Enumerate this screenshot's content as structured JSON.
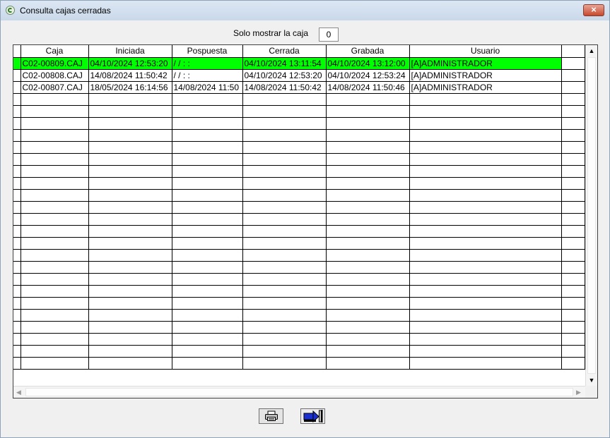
{
  "window": {
    "title": "Consulta cajas cerradas",
    "close_label": "×"
  },
  "filter": {
    "label": "Solo mostrar la caja",
    "value": "0"
  },
  "table": {
    "columns": [
      "Caja",
      "Iniciada",
      "Pospuesta",
      "Cerrada",
      "Grabada",
      "Usuario"
    ],
    "rows": [
      [
        "C02-00809.CAJ",
        "04/10/2024 12:53:20",
        "/ /       : :",
        "04/10/2024 13:11:54",
        "04/10/2024 13:12:00",
        "[A]ADMINISTRADOR"
      ],
      [
        "C02-00808.CAJ",
        "14/08/2024 11:50:42",
        "/ /       : :",
        "04/10/2024 12:53:20",
        "04/10/2024 12:53:24",
        "[A]ADMINISTRADOR"
      ],
      [
        "C02-00807.CAJ",
        "18/05/2024 16:14:56",
        "14/08/2024 11:50",
        "14/08/2024 11:50:42",
        "14/08/2024 11:50:46",
        "[A]ADMINISTRADOR"
      ]
    ],
    "selected_row": 0,
    "selected_color": "#00ff00"
  },
  "scrollbars": {
    "up_arrow": "▲",
    "down_arrow": "▼",
    "left_arrow": "◀",
    "right_arrow": "▶"
  },
  "buttons": {
    "print_icon": "printer-icon",
    "exit_icon": "exit-door-icon"
  }
}
